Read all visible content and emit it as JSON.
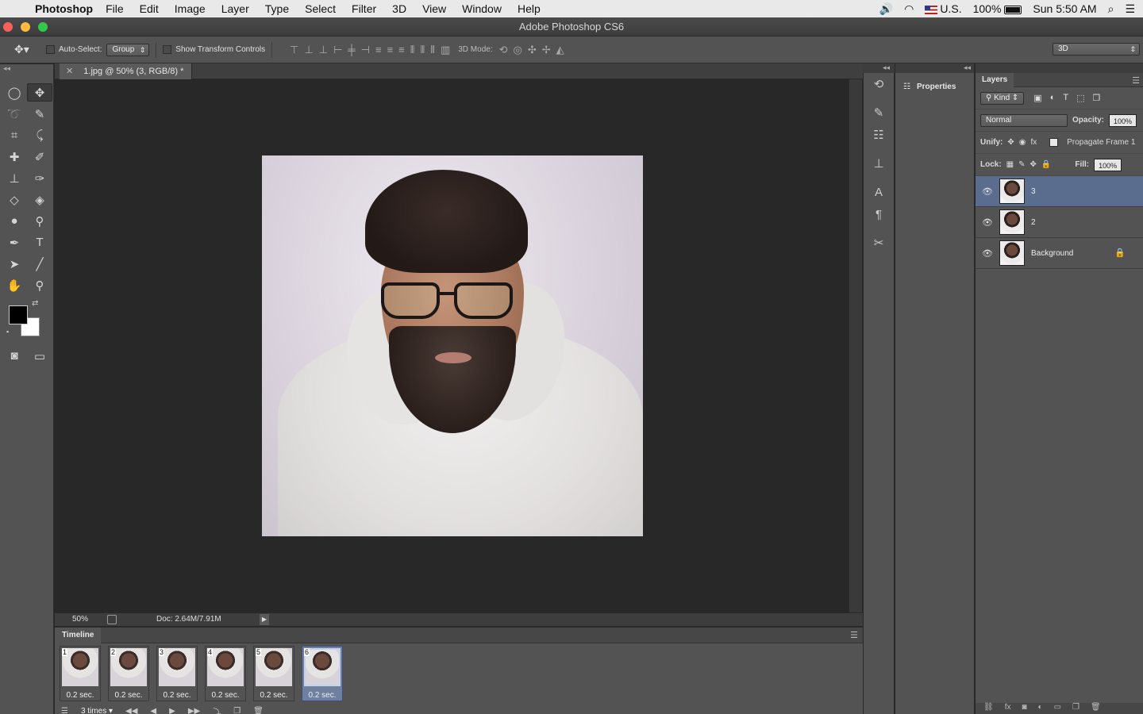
{
  "menubar": {
    "app": "Photoshop",
    "items": [
      "File",
      "Edit",
      "Image",
      "Layer",
      "Type",
      "Select",
      "Filter",
      "3D",
      "View",
      "Window",
      "Help"
    ],
    "input_source": "U.S.",
    "battery": "100%",
    "clock": "Sun 5:50 AM"
  },
  "window": {
    "title": "Adobe Photoshop CS6"
  },
  "options": {
    "auto_select_label": "Auto-Select:",
    "auto_select_value": "Group",
    "show_transform_label": "Show Transform Controls",
    "mode_3d_label": "3D Mode:",
    "workspace": "3D"
  },
  "document": {
    "tab_title": "1.jpg @ 50% (3, RGB/8) *"
  },
  "status": {
    "zoom": "50%",
    "doc_info": "Doc: 2.64M/7.91M"
  },
  "timeline": {
    "title": "Timeline",
    "frames": [
      {
        "num": "1",
        "delay": "0.2 sec."
      },
      {
        "num": "2",
        "delay": "0.2 sec."
      },
      {
        "num": "3",
        "delay": "0.2 sec."
      },
      {
        "num": "4",
        "delay": "0.2 sec."
      },
      {
        "num": "5",
        "delay": "0.2 sec."
      },
      {
        "num": "6",
        "delay": "0.2 sec."
      }
    ],
    "loop": "3 times"
  },
  "properties": {
    "label": "Properties"
  },
  "layers_panel": {
    "title": "Layers",
    "filter_kind": "Kind",
    "blend_mode": "Normal",
    "opacity_label": "Opacity:",
    "opacity": "100%",
    "unify_label": "Unify:",
    "propagate_label": "Propagate Frame 1",
    "lock_label": "Lock:",
    "fill_label": "Fill:",
    "fill": "100%",
    "layers": [
      {
        "name": "3",
        "selected": true
      },
      {
        "name": "2",
        "selected": false
      },
      {
        "name": "Background",
        "selected": false
      }
    ]
  }
}
